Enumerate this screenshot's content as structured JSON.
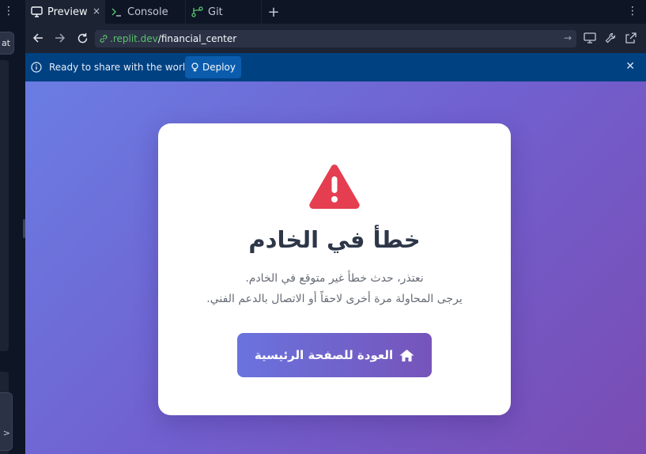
{
  "left_panel": {
    "menu_icon": "kebab-menu-icon",
    "chat_tab_fragment": "at"
  },
  "tabs": [
    {
      "label": "Preview",
      "icon": "monitor-icon",
      "active": true,
      "close": "×"
    },
    {
      "label": "Console",
      "icon": "terminal-icon",
      "active": false
    },
    {
      "label": "Git",
      "icon": "git-branch-icon",
      "active": false
    }
  ],
  "tabbar": {
    "add_icon": "plus-icon",
    "menu_icon": "kebab-menu-icon"
  },
  "urlbar": {
    "host": ".replit.dev",
    "path": "/financial_center",
    "link_icon": "link-icon",
    "go_icon": "arrow-right-icon",
    "tools": [
      "devices-icon",
      "wrench-icon",
      "external-link-icon"
    ]
  },
  "banner": {
    "message": "Ready to share with the world?",
    "deploy_label": "Deploy",
    "close_icon": "close-icon"
  },
  "error_card": {
    "title": "خطأ في الخادم",
    "line1": "نعتذر، حدث خطأ غير متوقع في الخادم.",
    "line2": "يرجى المحاولة مرة أخرى لاحقاً أو الاتصال بالدعم الفني.",
    "button_label": "العودة للصفحة الرئيسية",
    "button_icon": "home-icon",
    "alert_icon": "warning-triangle-icon"
  },
  "colors": {
    "url_host": "#58c36b",
    "banner_bg": "#004182",
    "warning_red": "#e53e51",
    "gradient_start": "#6a7de3",
    "gradient_end": "#7a4cb3"
  }
}
